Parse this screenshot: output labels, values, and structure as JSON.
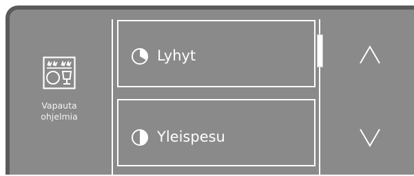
{
  "release_button": {
    "label": "Vapauta\nohjelmia",
    "icon": "dishwasher-program-release-icon"
  },
  "programs": [
    {
      "label": "Lyhyt",
      "icon": "clock-short-icon"
    },
    {
      "label": "Yleispesu",
      "icon": "clock-half-icon"
    }
  ],
  "scrollbar": {
    "position": 0.0
  },
  "navigation": {
    "up_icon": "chevron-up-icon",
    "down_icon": "chevron-down-icon"
  },
  "colors": {
    "panel": "#8a8a8a",
    "panel_border": "#5a5a5a",
    "foreground": "#ffffff"
  }
}
